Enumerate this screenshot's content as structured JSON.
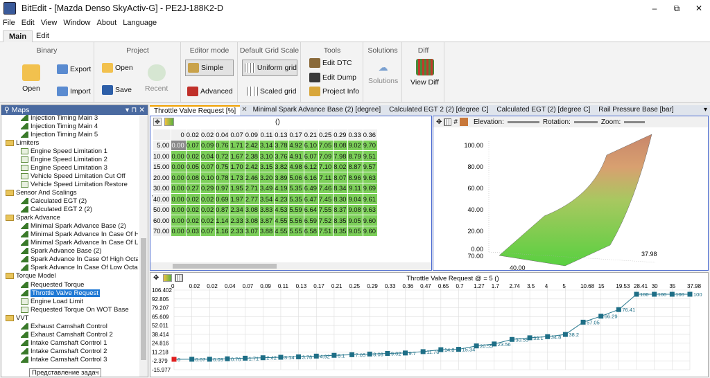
{
  "window": {
    "title": "BitEdit - [Mazda Denso SkyActiv-G] - PE2J-188K2-D",
    "minimize": "–",
    "restore": "⧉",
    "close": "✕"
  },
  "menu": [
    "File",
    "Edit",
    "View",
    "Window",
    "About",
    "Language"
  ],
  "ribbon_tabs": [
    "Main",
    "Edit"
  ],
  "ribbon": {
    "binary": {
      "title": "Binary",
      "open": "Open",
      "export": "Export",
      "import": "Import"
    },
    "project": {
      "title": "Project",
      "open": "Open",
      "save": "Save",
      "recent": "Recent"
    },
    "editor_mode": {
      "title": "Editor mode",
      "simple": "Simple",
      "advanced": "Advanced"
    },
    "grid_scale": {
      "title": "Default Grid Scale",
      "uniform": "Uniform grid",
      "scaled": "Scaled grid"
    },
    "tools": {
      "title": "Tools",
      "edit_dtc": "Edit DTC",
      "edit_dump": "Edit Dump",
      "project_info": "Project Info"
    },
    "solutions": {
      "title": "Solutions",
      "solutions": "Solutions"
    },
    "diff": {
      "title": "Diff",
      "view_diff": "View Diff"
    }
  },
  "maps_panel": {
    "title": "Maps",
    "pin": "▾ ⊓ ✕",
    "tooltip": "Представление задач"
  },
  "tree": [
    {
      "label": "Injection Timing Main 3",
      "type": "map",
      "indent": 1
    },
    {
      "label": "Injection Timing Main 4",
      "type": "map",
      "indent": 1
    },
    {
      "label": "Injection Timing Main 5",
      "type": "map",
      "indent": 1
    },
    {
      "label": "Limiters",
      "type": "folder",
      "indent": 0
    },
    {
      "label": "Engine Speed Limitation 1",
      "type": "table",
      "indent": 1
    },
    {
      "label": "Engine Speed Limitation 2",
      "type": "table",
      "indent": 1
    },
    {
      "label": "Engine Speed Limitation 3",
      "type": "table",
      "indent": 1
    },
    {
      "label": "Vehicle Speed Limitation Cut Off",
      "type": "table",
      "indent": 1
    },
    {
      "label": "Vehicle Speed Limitation Restore",
      "type": "table",
      "indent": 1
    },
    {
      "label": "Sensor And Scalings",
      "type": "folder",
      "indent": 0
    },
    {
      "label": "Calculated EGT (2)",
      "type": "map",
      "indent": 1
    },
    {
      "label": "Calculated EGT 2 (2)",
      "type": "map",
      "indent": 1
    },
    {
      "label": "Spark Advance",
      "type": "folder",
      "indent": 0
    },
    {
      "label": "Minimal Spark Advance Base (2)",
      "type": "map",
      "indent": 1
    },
    {
      "label": "Minimal Spark Advance In Case Of High",
      "type": "map",
      "indent": 1
    },
    {
      "label": "Minimal Spark Advance In Case Of Low",
      "type": "map",
      "indent": 1
    },
    {
      "label": "Spark Advance Base (2)",
      "type": "map",
      "indent": 1
    },
    {
      "label": "Spark Advance In Case Of High Octane",
      "type": "map",
      "indent": 1
    },
    {
      "label": "Spark Advance In Case Of Low Octane F",
      "type": "map",
      "indent": 1
    },
    {
      "label": "Torque Model",
      "type": "folder",
      "indent": 0
    },
    {
      "label": "Requested Torque",
      "type": "map",
      "indent": 1
    },
    {
      "label": "Throttle Valve Request",
      "type": "map",
      "indent": 1,
      "selected": true
    },
    {
      "label": "Engine Load Limit",
      "type": "table",
      "indent": 1
    },
    {
      "label": "Requested Torque On WOT Base",
      "type": "table",
      "indent": 1
    },
    {
      "label": "VVT",
      "type": "folder",
      "indent": 0
    },
    {
      "label": "Exhaust Camshaft Control",
      "type": "map",
      "indent": 1
    },
    {
      "label": "Exhaust Camshaft Control 2",
      "type": "map",
      "indent": 1
    },
    {
      "label": "Intake Camshaft Control 1",
      "type": "map",
      "indent": 1
    },
    {
      "label": "Intake Camshaft Control 2",
      "type": "map",
      "indent": 1
    },
    {
      "label": "Intake Camshaft Control 3",
      "type": "map",
      "indent": 1
    }
  ],
  "doc_tabs": [
    "Throttle Valve Request [%]",
    "Minimal Spark Advance Base (2) [degree]",
    "Calculated EGT 2 (2) [degree C]",
    "Calculated EGT (2) [degree C]",
    "Rail Pressure Base [bar]"
  ],
  "table": {
    "x_title": "()",
    "y_title": "()",
    "cols": [
      "0",
      "0.02",
      "0.02",
      "0.04",
      "0.07",
      "0.09",
      "0.11",
      "0.13",
      "0.17",
      "0.21",
      "0.25",
      "0.29",
      "0.33",
      "0.36"
    ],
    "rows": [
      {
        "y": "5.00",
        "v": [
          "0.00",
          "0.07",
          "0.09",
          "0.76",
          "1.71",
          "2.42",
          "3.14",
          "3.78",
          "4.92",
          "6.10",
          "7.05",
          "8.08",
          "9.02",
          "9.70"
        ]
      },
      {
        "y": "10.00",
        "v": [
          "0.00",
          "0.02",
          "0.04",
          "0.72",
          "1.67",
          "2.38",
          "3.10",
          "3.76",
          "4.91",
          "6.07",
          "7.09",
          "7.98",
          "8.79",
          "9.51"
        ]
      },
      {
        "y": "15.00",
        "v": [
          "0.00",
          "0.05",
          "0.07",
          "0.75",
          "1.70",
          "2.42",
          "3.15",
          "3.82",
          "4.98",
          "6.12",
          "7.10",
          "8.02",
          "8.87",
          "9.57"
        ]
      },
      {
        "y": "20.00",
        "v": [
          "0.00",
          "0.08",
          "0.10",
          "0.78",
          "1.73",
          "2.46",
          "3.20",
          "3.89",
          "5.06",
          "6.16",
          "7.11",
          "8.07",
          "8.96",
          "9.63"
        ]
      },
      {
        "y": "30.00",
        "v": [
          "0.00",
          "0.27",
          "0.29",
          "0.97",
          "1.95",
          "2.71",
          "3.49",
          "4.19",
          "5.35",
          "6.49",
          "7.46",
          "8.34",
          "9.11",
          "9.69"
        ]
      },
      {
        "y": "40.00",
        "v": [
          "0.00",
          "0.02",
          "0.02",
          "0.69",
          "1.97",
          "2.77",
          "3.54",
          "4.23",
          "5.35",
          "6.47",
          "7.45",
          "8.30",
          "9.04",
          "9.61"
        ]
      },
      {
        "y": "50.00",
        "v": [
          "0.00",
          "0.02",
          "0.02",
          "0.87",
          "2.34",
          "3.08",
          "3.83",
          "4.53",
          "5.59",
          "6.64",
          "7.55",
          "8.37",
          "9.08",
          "9.63"
        ]
      },
      {
        "y": "60.00",
        "v": [
          "0.00",
          "0.02",
          "0.02",
          "1.14",
          "2.33",
          "3.08",
          "3.87",
          "4.55",
          "5.56",
          "6.59",
          "7.52",
          "8.35",
          "9.05",
          "9.60"
        ]
      },
      {
        "y": "70.00",
        "v": [
          "0.00",
          "0.03",
          "0.07",
          "1.16",
          "2.33",
          "3.07",
          "3.88",
          "4.55",
          "5.55",
          "6.58",
          "7.51",
          "8.35",
          "9.05",
          "9.60"
        ]
      }
    ]
  },
  "view3d": {
    "elevation_label": "Elevation:",
    "rotation_label": "Rotation:",
    "zoom_label": "Zoom:",
    "z_ticks": [
      "100.00",
      "80.00",
      "60.00",
      "40.00",
      "20.00",
      "0.00"
    ],
    "y_labels": [
      "70.00",
      "40.00"
    ],
    "x_label": "37.98"
  },
  "chart_data": {
    "type": "line",
    "title": "Throttle Valve Request @ = 5 ()",
    "x": [
      "0",
      "0.02",
      "0.02",
      "0.04",
      "0.07",
      "0.09",
      "0.11",
      "0.13",
      "0.17",
      "0.21",
      "0.25",
      "0.29",
      "0.33",
      "0.36",
      "0.47",
      "0.65",
      "0.7",
      "1.27",
      "1.7",
      "2.74",
      "3.5",
      "4",
      "5",
      "10.68",
      "15",
      "19.53",
      "28.41",
      "30",
      "35",
      "37.98"
    ],
    "values": [
      0,
      0.07,
      0.09,
      0.76,
      1.71,
      2.42,
      3.14,
      3.78,
      4.92,
      6.1,
      7.05,
      8.08,
      9.02,
      9.7,
      11.78,
      14.8,
      15.34,
      20.55,
      23.56,
      30.55,
      33.1,
      34.8,
      38.2,
      57.05,
      66.29,
      76.41,
      100,
      100,
      100,
      100
    ],
    "y_ticks": [
      "106.402",
      "92.805",
      "79.207",
      "65.609",
      "52.011",
      "38.414",
      "24.816",
      "11.218",
      "-2.379",
      "-15.977"
    ],
    "ylim": [
      -15.977,
      106.402
    ],
    "line_color": "#2a7a90",
    "marker_color": "#1e6e86",
    "first_marker_color": "#e02020"
  }
}
